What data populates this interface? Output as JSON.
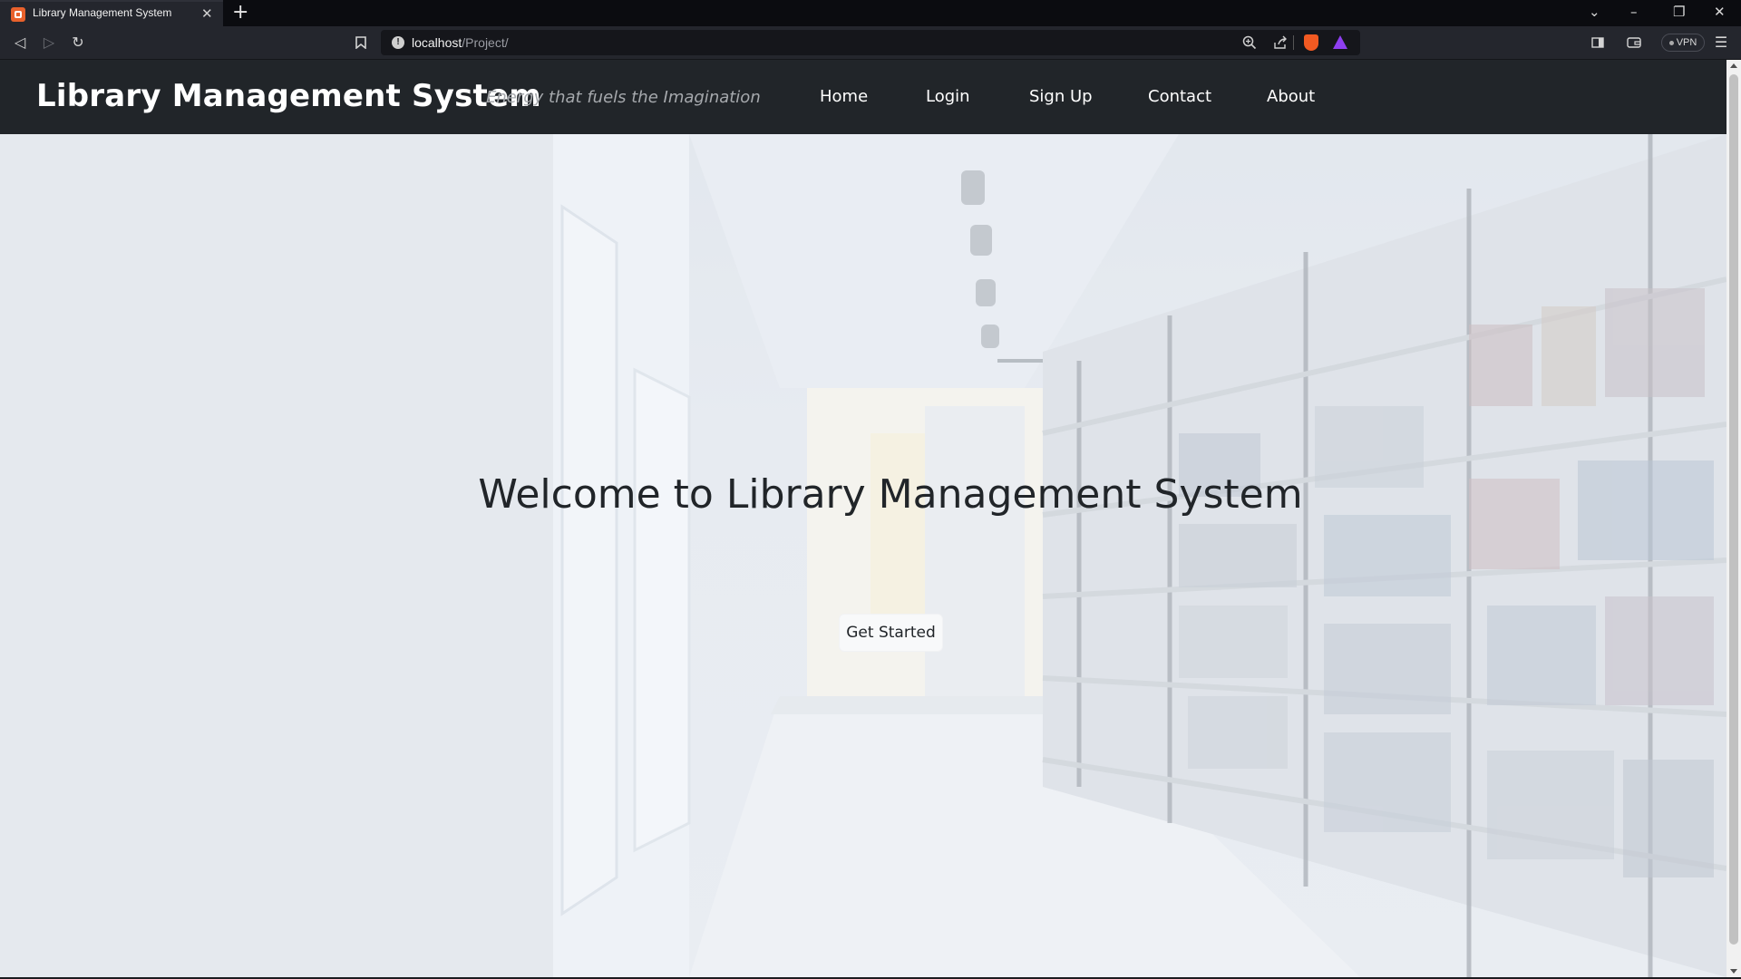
{
  "browser": {
    "tab_title": "Library Management System",
    "tab_close": "✕",
    "new_tab": "+",
    "url_host": "localhost",
    "url_path": "/Project/",
    "vpn_label": "VPN",
    "icons": [
      "back-icon",
      "forward-icon",
      "reload-icon",
      "bookmark-icon",
      "info-icon",
      "zoom-icon",
      "share-icon",
      "brave-shield-icon",
      "brave-rewards-icon",
      "sidebar-icon",
      "wallet-icon",
      "menu-icon"
    ]
  },
  "navbar": {
    "brand": "Library Management System",
    "tagline": "Energy that fuels the Imagination",
    "links": [
      {
        "label": "Home"
      },
      {
        "label": "Login"
      },
      {
        "label": "Sign Up"
      },
      {
        "label": "Contact"
      },
      {
        "label": "About"
      }
    ]
  },
  "hero": {
    "title": "Welcome to Library Management System",
    "button": "Get Started"
  },
  "colors": {
    "navbar_bg": "#212529",
    "hero_text": "#212529",
    "button_bg": "#f8f9fa",
    "tab_favicon": "#e8612c"
  }
}
